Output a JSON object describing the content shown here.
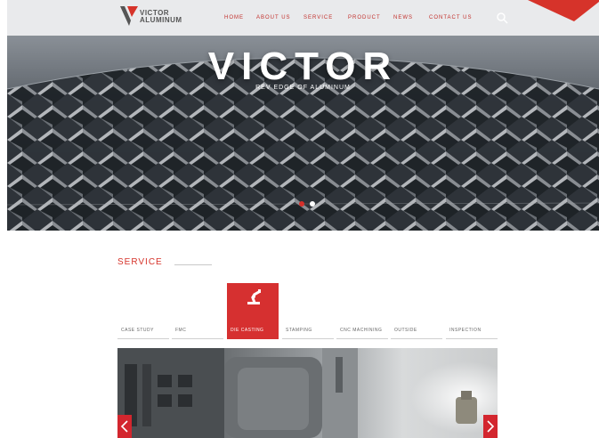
{
  "header": {
    "logo": {
      "line1": "VICTOR",
      "line2": "ALUMINUM"
    },
    "nav": [
      "HOME",
      "ABOUT US",
      "SERVICE",
      "PRODUCT",
      "NEWS",
      "CONTACT US"
    ]
  },
  "hero": {
    "title": "VICTOR",
    "subtitle": "REV EDGE OF ALUMINUM",
    "slide_current": 1,
    "slide_count": 2
  },
  "service": {
    "title": "SERVICE",
    "tabs": [
      {
        "label": "CASE STUDY",
        "active": false
      },
      {
        "label": "FMC",
        "active": false
      },
      {
        "label": "DIE CASTING",
        "active": true,
        "icon": "robot-arm-icon"
      },
      {
        "label": "STAMPING",
        "active": false
      },
      {
        "label": "CNC MACHINING",
        "active": false
      },
      {
        "label": "OUTSIDE",
        "active": false
      },
      {
        "label": "INSPECTION",
        "active": false
      }
    ]
  },
  "colors": {
    "accent": "#d6332a",
    "header_bg": "#e9eaec"
  }
}
